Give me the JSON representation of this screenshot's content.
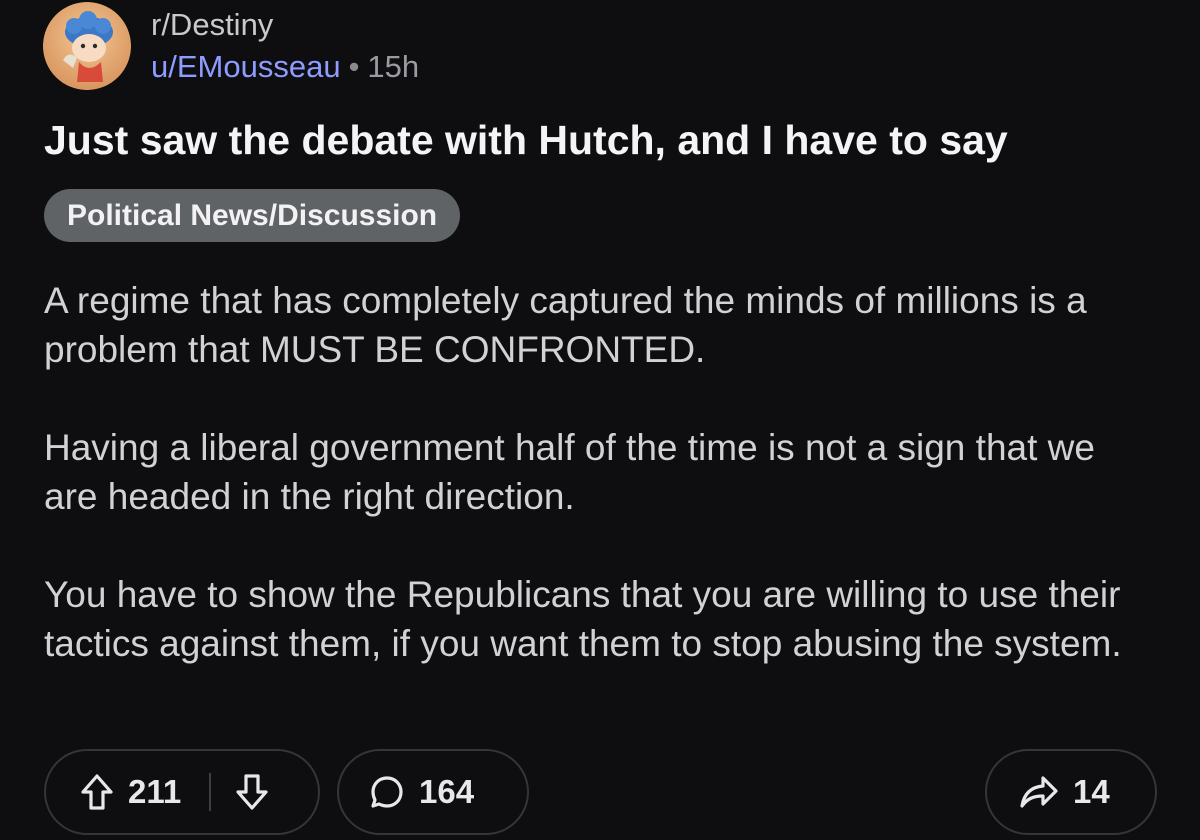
{
  "header": {
    "subreddit": "r/Destiny",
    "username": "u/EMousseau",
    "separator": "•",
    "age": "15h"
  },
  "post": {
    "title": "Just saw the debate with Hutch, and I have to say",
    "flair": "Political News/Discussion",
    "paragraphs": [
      "A regime that has completely captured the minds of millions is a problem that MUST BE CONFRONTED.",
      "Having a liberal government half of the time is not a sign that we are headed in the right direction.",
      "You have to show the Republicans that you are willing to use their tactics against them, if you want them to stop abusing the system."
    ]
  },
  "actions": {
    "upvotes": "211",
    "comments": "164",
    "shares": "14"
  },
  "icons": {
    "avatar": "user-avatar",
    "upvote": "upvote-arrow-icon",
    "downvote": "downvote-arrow-icon",
    "comment": "comment-bubble-icon",
    "share": "share-arrow-icon"
  },
  "colors": {
    "background": "#0e0e10",
    "username": "#8e9cff",
    "flair_bg": "#5f6366"
  }
}
